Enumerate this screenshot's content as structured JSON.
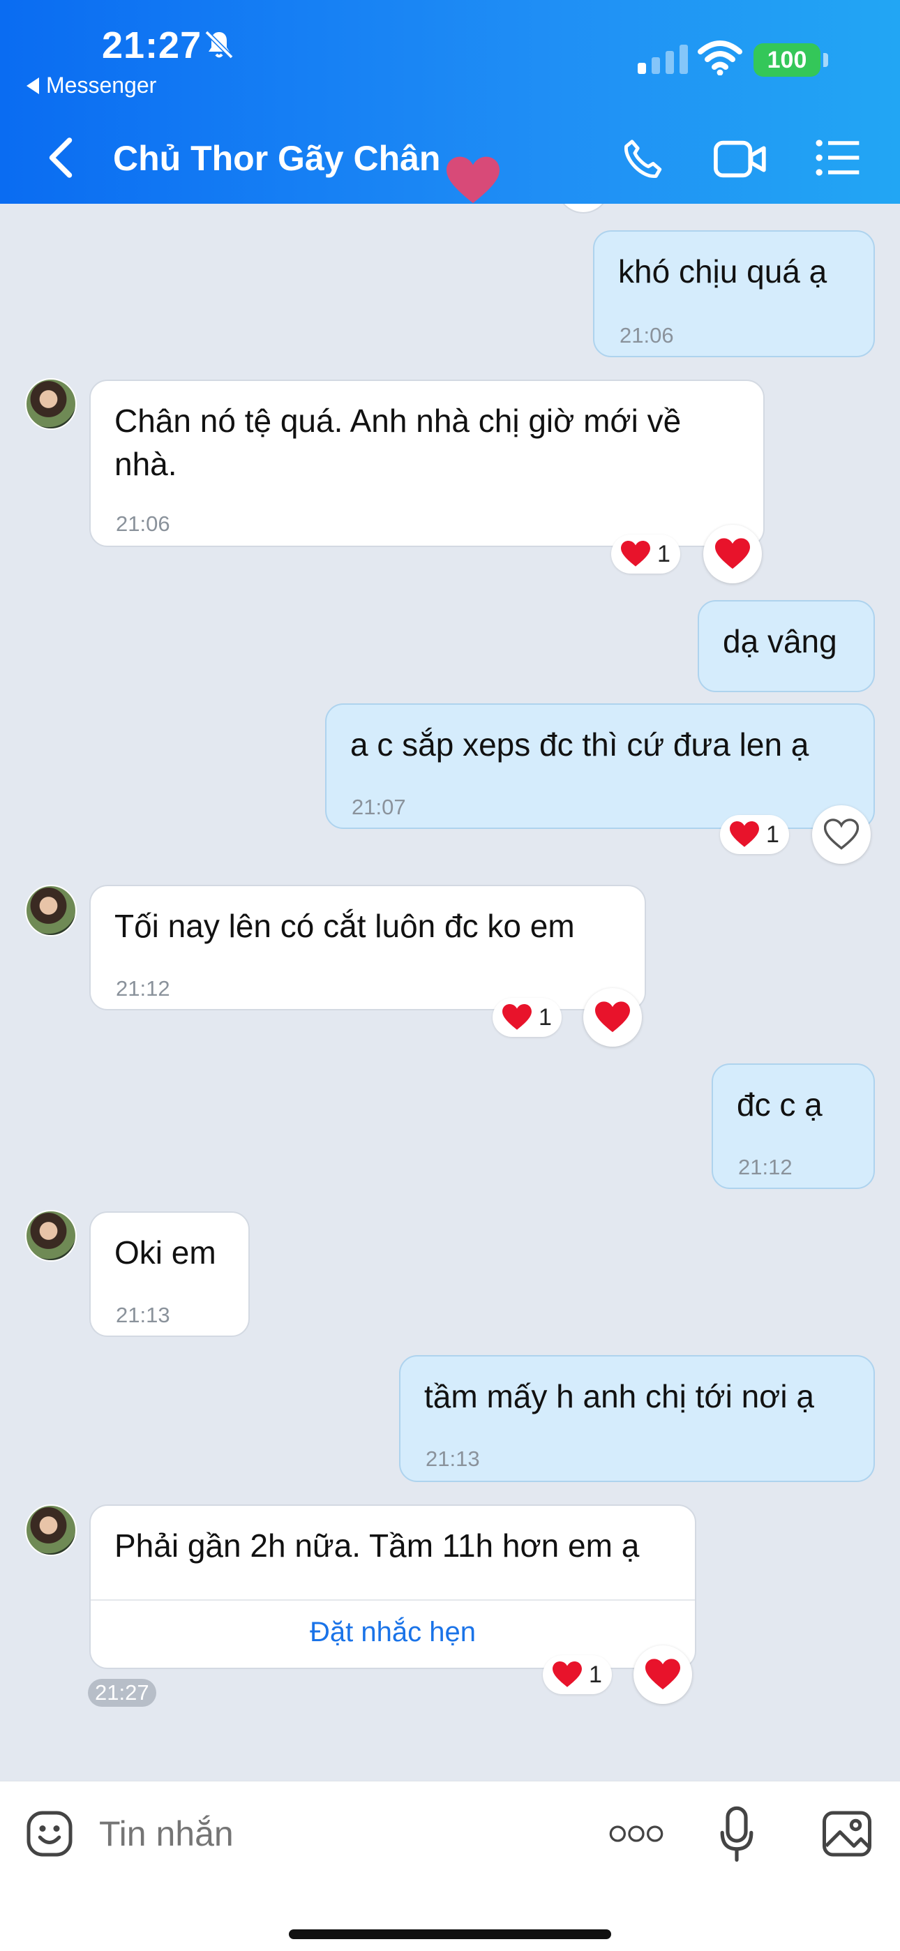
{
  "status_bar": {
    "time": "21:27",
    "back_app_label": "Messenger",
    "battery": "100"
  },
  "header": {
    "title": "Chủ Thor Gãy Chân"
  },
  "messages": [
    {
      "side": "out",
      "text": "khó chịu quá ạ",
      "time": "21:06"
    },
    {
      "side": "in",
      "text": "Chân nó tệ quá. Anh nhà chị giờ mới về nhà.",
      "time": "21:06",
      "reaction_count": "1"
    },
    {
      "side": "out",
      "text": "dạ vâng"
    },
    {
      "side": "out",
      "text": "a c sắp xeps đc thì cứ đưa len ạ",
      "time": "21:07",
      "reaction_count": "1"
    },
    {
      "side": "in",
      "text": "Tối nay lên có cắt luôn đc ko em",
      "time": "21:12",
      "reaction_count": "1"
    },
    {
      "side": "out",
      "text": "đc c ạ",
      "time": "21:12"
    },
    {
      "side": "in",
      "text": "Oki em",
      "time": "21:13"
    },
    {
      "side": "out",
      "text": "tầm mấy h anh chị tới nơi ạ",
      "time": "21:13"
    },
    {
      "side": "in",
      "text": "Phải gần 2h nữa. Tầm 11h hơn em ạ",
      "action": "Đặt nhắc hẹn",
      "time": "21:27",
      "reaction_count": "1"
    }
  ],
  "input": {
    "placeholder": "Tin nhắn"
  },
  "colors": {
    "header_start": "#0a6cf2",
    "header_end": "#22a6f4",
    "outgoing_bubble": "#d5ecfc",
    "heart": "#e8132b",
    "link": "#1a73e8"
  },
  "icons": [
    "bell-off-icon",
    "back-icon",
    "phone-icon",
    "video-icon",
    "menu-icon",
    "heart-icon",
    "emoji-icon",
    "more-icon",
    "microphone-icon",
    "image-icon"
  ]
}
